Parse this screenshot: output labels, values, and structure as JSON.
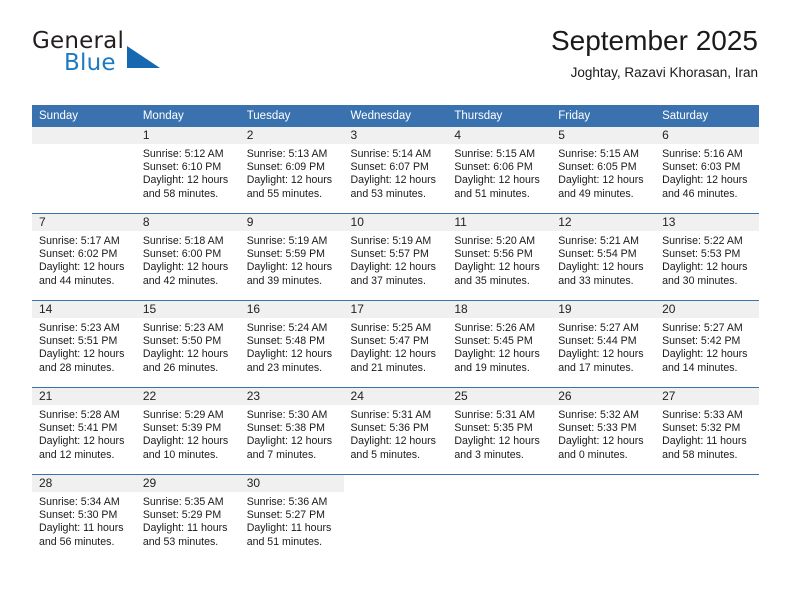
{
  "brand": {
    "name_top": "General",
    "name_bottom": "Blue",
    "accent_color": "#1668b0",
    "text_color": "#231f20"
  },
  "header": {
    "title": "September 2025",
    "subtitle": "Joghtay, Razavi Khorasan, Iran"
  },
  "theme": {
    "header_blue": "#3a72b0",
    "daynum_band": "#f0f0f0",
    "page_background": "#ffffff"
  },
  "calendar": {
    "weekday_headers": [
      "Sunday",
      "Monday",
      "Tuesday",
      "Wednesday",
      "Thursday",
      "Friday",
      "Saturday"
    ],
    "weeks": [
      [
        {
          "day": "",
          "lines": []
        },
        {
          "day": "1",
          "lines": [
            "Sunrise: 5:12 AM",
            "Sunset: 6:10 PM",
            "Daylight: 12 hours",
            "and 58 minutes."
          ]
        },
        {
          "day": "2",
          "lines": [
            "Sunrise: 5:13 AM",
            "Sunset: 6:09 PM",
            "Daylight: 12 hours",
            "and 55 minutes."
          ]
        },
        {
          "day": "3",
          "lines": [
            "Sunrise: 5:14 AM",
            "Sunset: 6:07 PM",
            "Daylight: 12 hours",
            "and 53 minutes."
          ]
        },
        {
          "day": "4",
          "lines": [
            "Sunrise: 5:15 AM",
            "Sunset: 6:06 PM",
            "Daylight: 12 hours",
            "and 51 minutes."
          ]
        },
        {
          "day": "5",
          "lines": [
            "Sunrise: 5:15 AM",
            "Sunset: 6:05 PM",
            "Daylight: 12 hours",
            "and 49 minutes."
          ]
        },
        {
          "day": "6",
          "lines": [
            "Sunrise: 5:16 AM",
            "Sunset: 6:03 PM",
            "Daylight: 12 hours",
            "and 46 minutes."
          ]
        }
      ],
      [
        {
          "day": "7",
          "lines": [
            "Sunrise: 5:17 AM",
            "Sunset: 6:02 PM",
            "Daylight: 12 hours",
            "and 44 minutes."
          ]
        },
        {
          "day": "8",
          "lines": [
            "Sunrise: 5:18 AM",
            "Sunset: 6:00 PM",
            "Daylight: 12 hours",
            "and 42 minutes."
          ]
        },
        {
          "day": "9",
          "lines": [
            "Sunrise: 5:19 AM",
            "Sunset: 5:59 PM",
            "Daylight: 12 hours",
            "and 39 minutes."
          ]
        },
        {
          "day": "10",
          "lines": [
            "Sunrise: 5:19 AM",
            "Sunset: 5:57 PM",
            "Daylight: 12 hours",
            "and 37 minutes."
          ]
        },
        {
          "day": "11",
          "lines": [
            "Sunrise: 5:20 AM",
            "Sunset: 5:56 PM",
            "Daylight: 12 hours",
            "and 35 minutes."
          ]
        },
        {
          "day": "12",
          "lines": [
            "Sunrise: 5:21 AM",
            "Sunset: 5:54 PM",
            "Daylight: 12 hours",
            "and 33 minutes."
          ]
        },
        {
          "day": "13",
          "lines": [
            "Sunrise: 5:22 AM",
            "Sunset: 5:53 PM",
            "Daylight: 12 hours",
            "and 30 minutes."
          ]
        }
      ],
      [
        {
          "day": "14",
          "lines": [
            "Sunrise: 5:23 AM",
            "Sunset: 5:51 PM",
            "Daylight: 12 hours",
            "and 28 minutes."
          ]
        },
        {
          "day": "15",
          "lines": [
            "Sunrise: 5:23 AM",
            "Sunset: 5:50 PM",
            "Daylight: 12 hours",
            "and 26 minutes."
          ]
        },
        {
          "day": "16",
          "lines": [
            "Sunrise: 5:24 AM",
            "Sunset: 5:48 PM",
            "Daylight: 12 hours",
            "and 23 minutes."
          ]
        },
        {
          "day": "17",
          "lines": [
            "Sunrise: 5:25 AM",
            "Sunset: 5:47 PM",
            "Daylight: 12 hours",
            "and 21 minutes."
          ]
        },
        {
          "day": "18",
          "lines": [
            "Sunrise: 5:26 AM",
            "Sunset: 5:45 PM",
            "Daylight: 12 hours",
            "and 19 minutes."
          ]
        },
        {
          "day": "19",
          "lines": [
            "Sunrise: 5:27 AM",
            "Sunset: 5:44 PM",
            "Daylight: 12 hours",
            "and 17 minutes."
          ]
        },
        {
          "day": "20",
          "lines": [
            "Sunrise: 5:27 AM",
            "Sunset: 5:42 PM",
            "Daylight: 12 hours",
            "and 14 minutes."
          ]
        }
      ],
      [
        {
          "day": "21",
          "lines": [
            "Sunrise: 5:28 AM",
            "Sunset: 5:41 PM",
            "Daylight: 12 hours",
            "and 12 minutes."
          ]
        },
        {
          "day": "22",
          "lines": [
            "Sunrise: 5:29 AM",
            "Sunset: 5:39 PM",
            "Daylight: 12 hours",
            "and 10 minutes."
          ]
        },
        {
          "day": "23",
          "lines": [
            "Sunrise: 5:30 AM",
            "Sunset: 5:38 PM",
            "Daylight: 12 hours",
            "and 7 minutes."
          ]
        },
        {
          "day": "24",
          "lines": [
            "Sunrise: 5:31 AM",
            "Sunset: 5:36 PM",
            "Daylight: 12 hours",
            "and 5 minutes."
          ]
        },
        {
          "day": "25",
          "lines": [
            "Sunrise: 5:31 AM",
            "Sunset: 5:35 PM",
            "Daylight: 12 hours",
            "and 3 minutes."
          ]
        },
        {
          "day": "26",
          "lines": [
            "Sunrise: 5:32 AM",
            "Sunset: 5:33 PM",
            "Daylight: 12 hours",
            "and 0 minutes."
          ]
        },
        {
          "day": "27",
          "lines": [
            "Sunrise: 5:33 AM",
            "Sunset: 5:32 PM",
            "Daylight: 11 hours",
            "and 58 minutes."
          ]
        }
      ],
      [
        {
          "day": "28",
          "lines": [
            "Sunrise: 5:34 AM",
            "Sunset: 5:30 PM",
            "Daylight: 11 hours",
            "and 56 minutes."
          ]
        },
        {
          "day": "29",
          "lines": [
            "Sunrise: 5:35 AM",
            "Sunset: 5:29 PM",
            "Daylight: 11 hours",
            "and 53 minutes."
          ]
        },
        {
          "day": "30",
          "lines": [
            "Sunrise: 5:36 AM",
            "Sunset: 5:27 PM",
            "Daylight: 11 hours",
            "and 51 minutes."
          ]
        },
        {
          "day": "",
          "lines": []
        },
        {
          "day": "",
          "lines": []
        },
        {
          "day": "",
          "lines": []
        },
        {
          "day": "",
          "lines": []
        }
      ]
    ]
  }
}
